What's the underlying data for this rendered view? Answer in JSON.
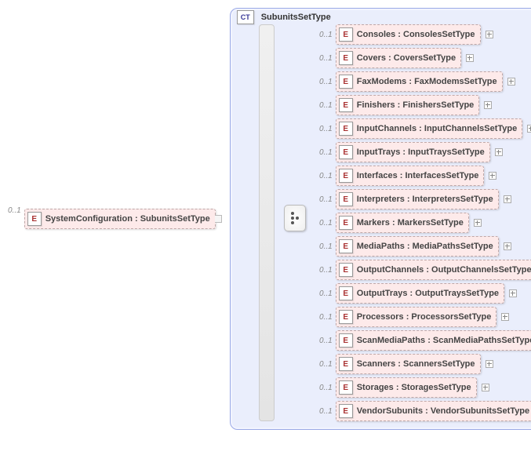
{
  "root": {
    "cardinality": "0..1",
    "badge": "E",
    "label": "SystemConfiguration : SubunitsSetType"
  },
  "complexType": {
    "badge": "CT",
    "title": "SubunitsSetType"
  },
  "children": [
    {
      "cardinality": "0..1",
      "badge": "E",
      "label": "Consoles : ConsolesSetType"
    },
    {
      "cardinality": "0..1",
      "badge": "E",
      "label": "Covers  : CoversSetType"
    },
    {
      "cardinality": "0..1",
      "badge": "E",
      "label": "FaxModems : FaxModemsSetType"
    },
    {
      "cardinality": "0..1",
      "badge": "E",
      "label": "Finishers : FinishersSetType"
    },
    {
      "cardinality": "0..1",
      "badge": "E",
      "label": "InputChannels : InputChannelsSetType"
    },
    {
      "cardinality": "0..1",
      "badge": "E",
      "label": "InputTrays : InputTraysSetType"
    },
    {
      "cardinality": "0..1",
      "badge": "E",
      "label": "Interfaces : InterfacesSetType"
    },
    {
      "cardinality": "0..1",
      "badge": "E",
      "label": "Interpreters : InterpretersSetType"
    },
    {
      "cardinality": "0..1",
      "badge": "E",
      "label": "Markers : MarkersSetType"
    },
    {
      "cardinality": "0..1",
      "badge": "E",
      "label": "MediaPaths : MediaPathsSetType"
    },
    {
      "cardinality": "0..1",
      "badge": "E",
      "label": "OutputChannels : OutputChannelsSetType"
    },
    {
      "cardinality": "0..1",
      "badge": "E",
      "label": "OutputTrays : OutputTraysSetType"
    },
    {
      "cardinality": "0..1",
      "badge": "E",
      "label": "Processors : ProcessorsSetType"
    },
    {
      "cardinality": "0..1",
      "badge": "E",
      "label": "ScanMediaPaths : ScanMediaPathsSetType"
    },
    {
      "cardinality": "0..1",
      "badge": "E",
      "label": "Scanners : ScannersSetType"
    },
    {
      "cardinality": "0..1",
      "badge": "E",
      "label": "Storages : StoragesSetType"
    },
    {
      "cardinality": "0..1",
      "badge": "E",
      "label": "VendorSubunits : VendorSubunitsSetType"
    }
  ]
}
